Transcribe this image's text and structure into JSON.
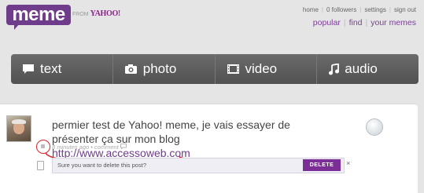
{
  "header": {
    "logo_text": "meme",
    "from_label": "FROM",
    "yahoo_label": "YAHOO!",
    "top_links": [
      "home",
      "0 followers",
      "settings",
      "sign out"
    ],
    "main_links": [
      "popular",
      "find",
      "your memes"
    ]
  },
  "composer": {
    "tabs": [
      {
        "label": "text",
        "icon": "speech-bubble-icon"
      },
      {
        "label": "photo",
        "icon": "camera-icon"
      },
      {
        "label": "video",
        "icon": "film-icon"
      },
      {
        "label": "audio",
        "icon": "music-note-icon"
      }
    ]
  },
  "post": {
    "text": "permier test de Yahoo! meme, je vais essayer de présenter ça sur mon blog ",
    "link": "http://www.accessoweb.com",
    "meta": "8 minutes ago • comment",
    "confirm_text": "Sure you want to delete this post?",
    "delete_label": "DELETE",
    "close_label": "×"
  },
  "colors": {
    "brand": "#6f3c8c",
    "composer_bg": "#5a5a5a",
    "highlight": "#d3252b"
  }
}
